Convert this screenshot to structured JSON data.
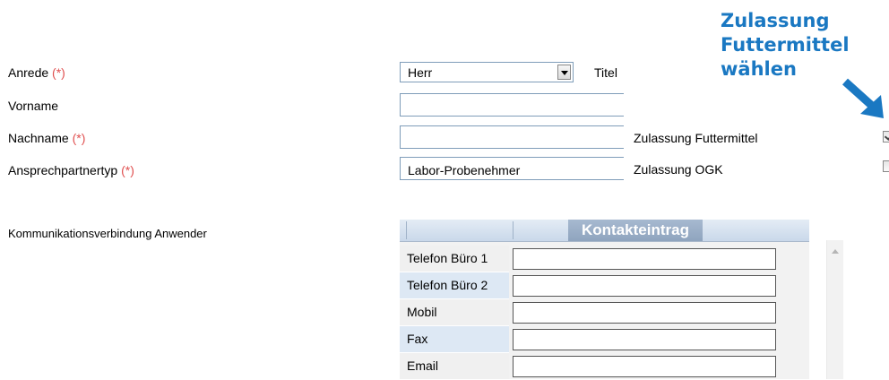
{
  "form": {
    "anrede": {
      "label": "Anrede",
      "required": "(*)",
      "value": "Herr"
    },
    "titel": {
      "label": "Titel"
    },
    "vorname": {
      "label": "Vorname",
      "value": ""
    },
    "nachname": {
      "label": "Nachname",
      "required": "(*)",
      "value": ""
    },
    "ansprechpartnertyp": {
      "label": "Ansprechpartnertyp",
      "required": "(*)",
      "value": "Labor-Probenehmer"
    },
    "zulassung_futtermittel": {
      "label": "Zulassung Futtermittel",
      "checked": true
    },
    "zulassung_ogk": {
      "label": "Zulassung OGK",
      "checked": false
    },
    "kommunikation_label": "Kommunikationsverbindung Anwender"
  },
  "callout": {
    "lines": [
      "Zulassung",
      "Futtermittel",
      "wählen"
    ],
    "color": "#1a78c2"
  },
  "contacts": {
    "header": "Kontakteintrag",
    "rows": [
      {
        "label": "Telefon Büro 1",
        "value": ""
      },
      {
        "label": "Telefon Büro 2",
        "value": ""
      },
      {
        "label": "Mobil",
        "value": ""
      },
      {
        "label": "Fax",
        "value": ""
      },
      {
        "label": "Email",
        "value": ""
      }
    ]
  }
}
